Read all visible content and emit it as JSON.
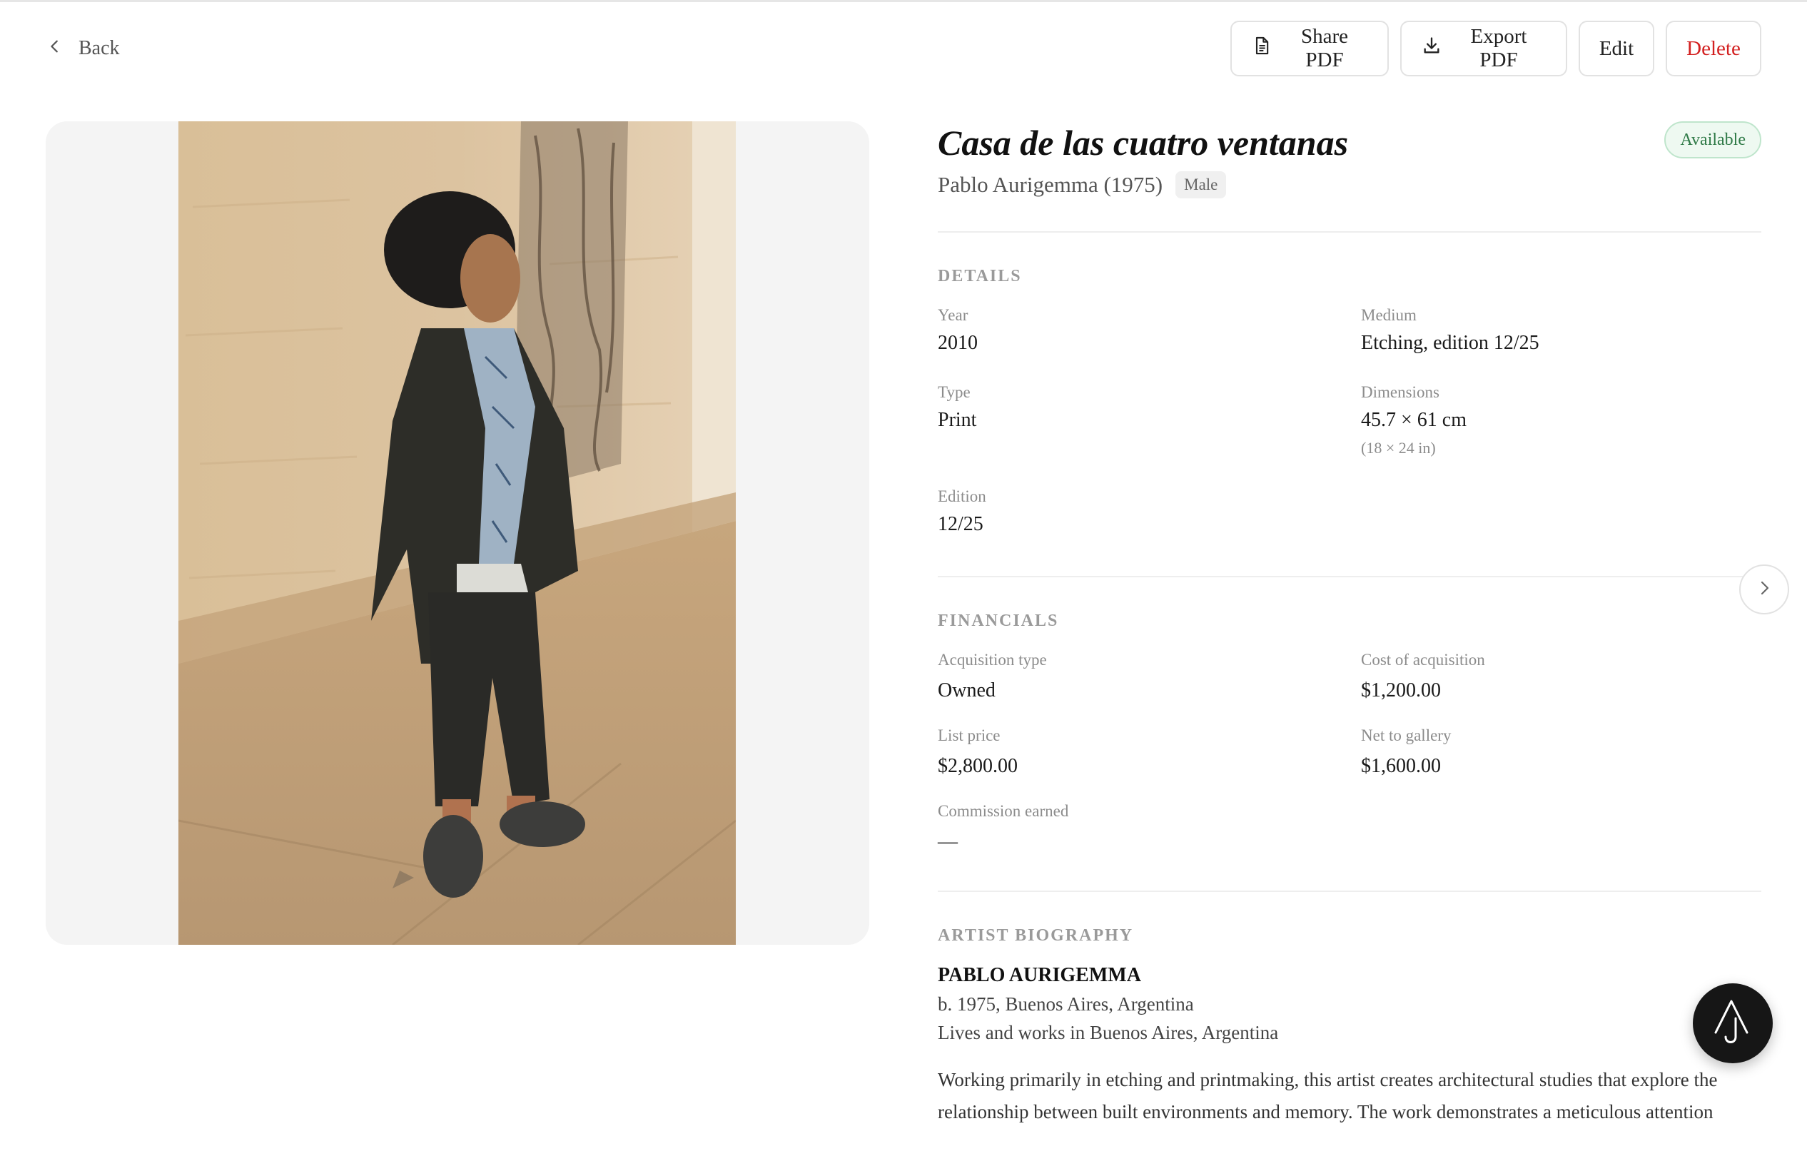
{
  "header": {
    "back_label": "Back",
    "actions": {
      "share_pdf": "Share PDF",
      "export_pdf": "Export PDF",
      "edit": "Edit",
      "delete": "Delete"
    }
  },
  "artwork": {
    "title": "Casa de las cuatro ventanas",
    "artist": "Pablo Aurigemma (1975)",
    "gender_tag": "Male",
    "status": "Available",
    "image_icon": "painting-of-standing-person"
  },
  "details": {
    "section_label": "DETAILS",
    "year_label": "Year",
    "year": "2010",
    "medium_label": "Medium",
    "medium": "Etching, edition 12/25",
    "type_label": "Type",
    "type": "Print",
    "dimensions_label": "Dimensions",
    "dimensions": "45.7 × 61 cm",
    "dimensions_in": "(18 × 24 in)",
    "edition_label": "Edition",
    "edition": "12/25"
  },
  "financials": {
    "section_label": "FINANCIALS",
    "acquisition_type_label": "Acquisition type",
    "acquisition_type": "Owned",
    "cost_label": "Cost of acquisition",
    "cost": "$1,200.00",
    "list_price_label": "List price",
    "list_price": "$2,800.00",
    "net_label": "Net to gallery",
    "net": "$1,600.00",
    "commission_label": "Commission earned",
    "commission": "—"
  },
  "biography": {
    "section_label": "ARTIST BIOGRAPHY",
    "name": "PABLO AURIGEMMA",
    "born": "b. 1975, Buenos Aires, Argentina",
    "lives": "Lives and works in Buenos Aires, Argentina",
    "text": "Working primarily in etching and printmaking, this artist creates architectural studies that explore the relationship between built environments and memory. The work demonstrates a meticulous attention"
  },
  "icons": {
    "back": "chevron-left-icon",
    "share": "document-icon",
    "export": "download-icon",
    "next": "chevron-right-icon",
    "assistant": "assistant-logo-icon"
  },
  "colors": {
    "delete": "#d32020",
    "status_text": "#2f7a47",
    "status_bg": "#eef9f1",
    "fab_bg": "#161616"
  }
}
